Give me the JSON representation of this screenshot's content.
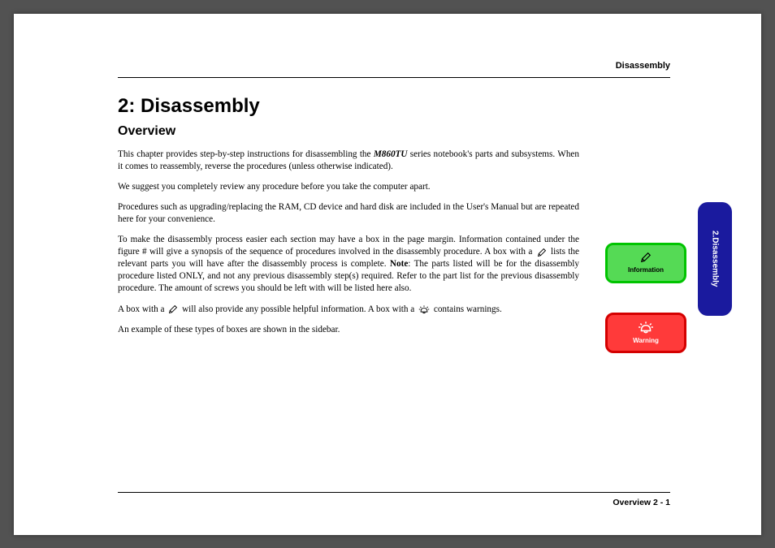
{
  "header": {
    "right": "Disassembly"
  },
  "chapter": {
    "title": "2: Disassembly",
    "section": "Overview"
  },
  "paragraphs": {
    "p1a": "This chapter provides step-by-step instructions for disassembling the ",
    "p1_model": "M860TU",
    "p1b": " series notebook's parts and subsystems. When it comes to reassembly, reverse the procedures (unless otherwise indicated).",
    "p2": "We suggest you completely review any procedure before you take the computer apart.",
    "p3": "Procedures such as upgrading/replacing the RAM, CD device and hard disk are included in the User's Manual but are repeated here for your convenience.",
    "p4a": "To make the disassembly process easier each section may have a box in the page margin. Information contained under the figure # will give a synopsis of the sequence of procedures involved in the disassembly procedure. A box with a ",
    "p4b": " lists the relevant parts you will have after the disassembly process is complete. ",
    "p4_note": "Note",
    "p4c": ": The parts listed will be for the disassembly procedure listed ONLY, and not any previous disassembly step(s) required. Refer to the part list for the previous disassembly procedure. The amount of screws you should be left with will be listed here also.",
    "p5a": "A box with a ",
    "p5b": " will also provide any possible helpful information. A box with a ",
    "p5c": " contains warnings.",
    "p6": "An example of these types of boxes are shown in the sidebar."
  },
  "sidebar": {
    "info_label": "Information",
    "warn_label": "Warning",
    "tab_label": "2.Disassembly"
  },
  "footer": {
    "right": "Overview  2  -  1"
  }
}
